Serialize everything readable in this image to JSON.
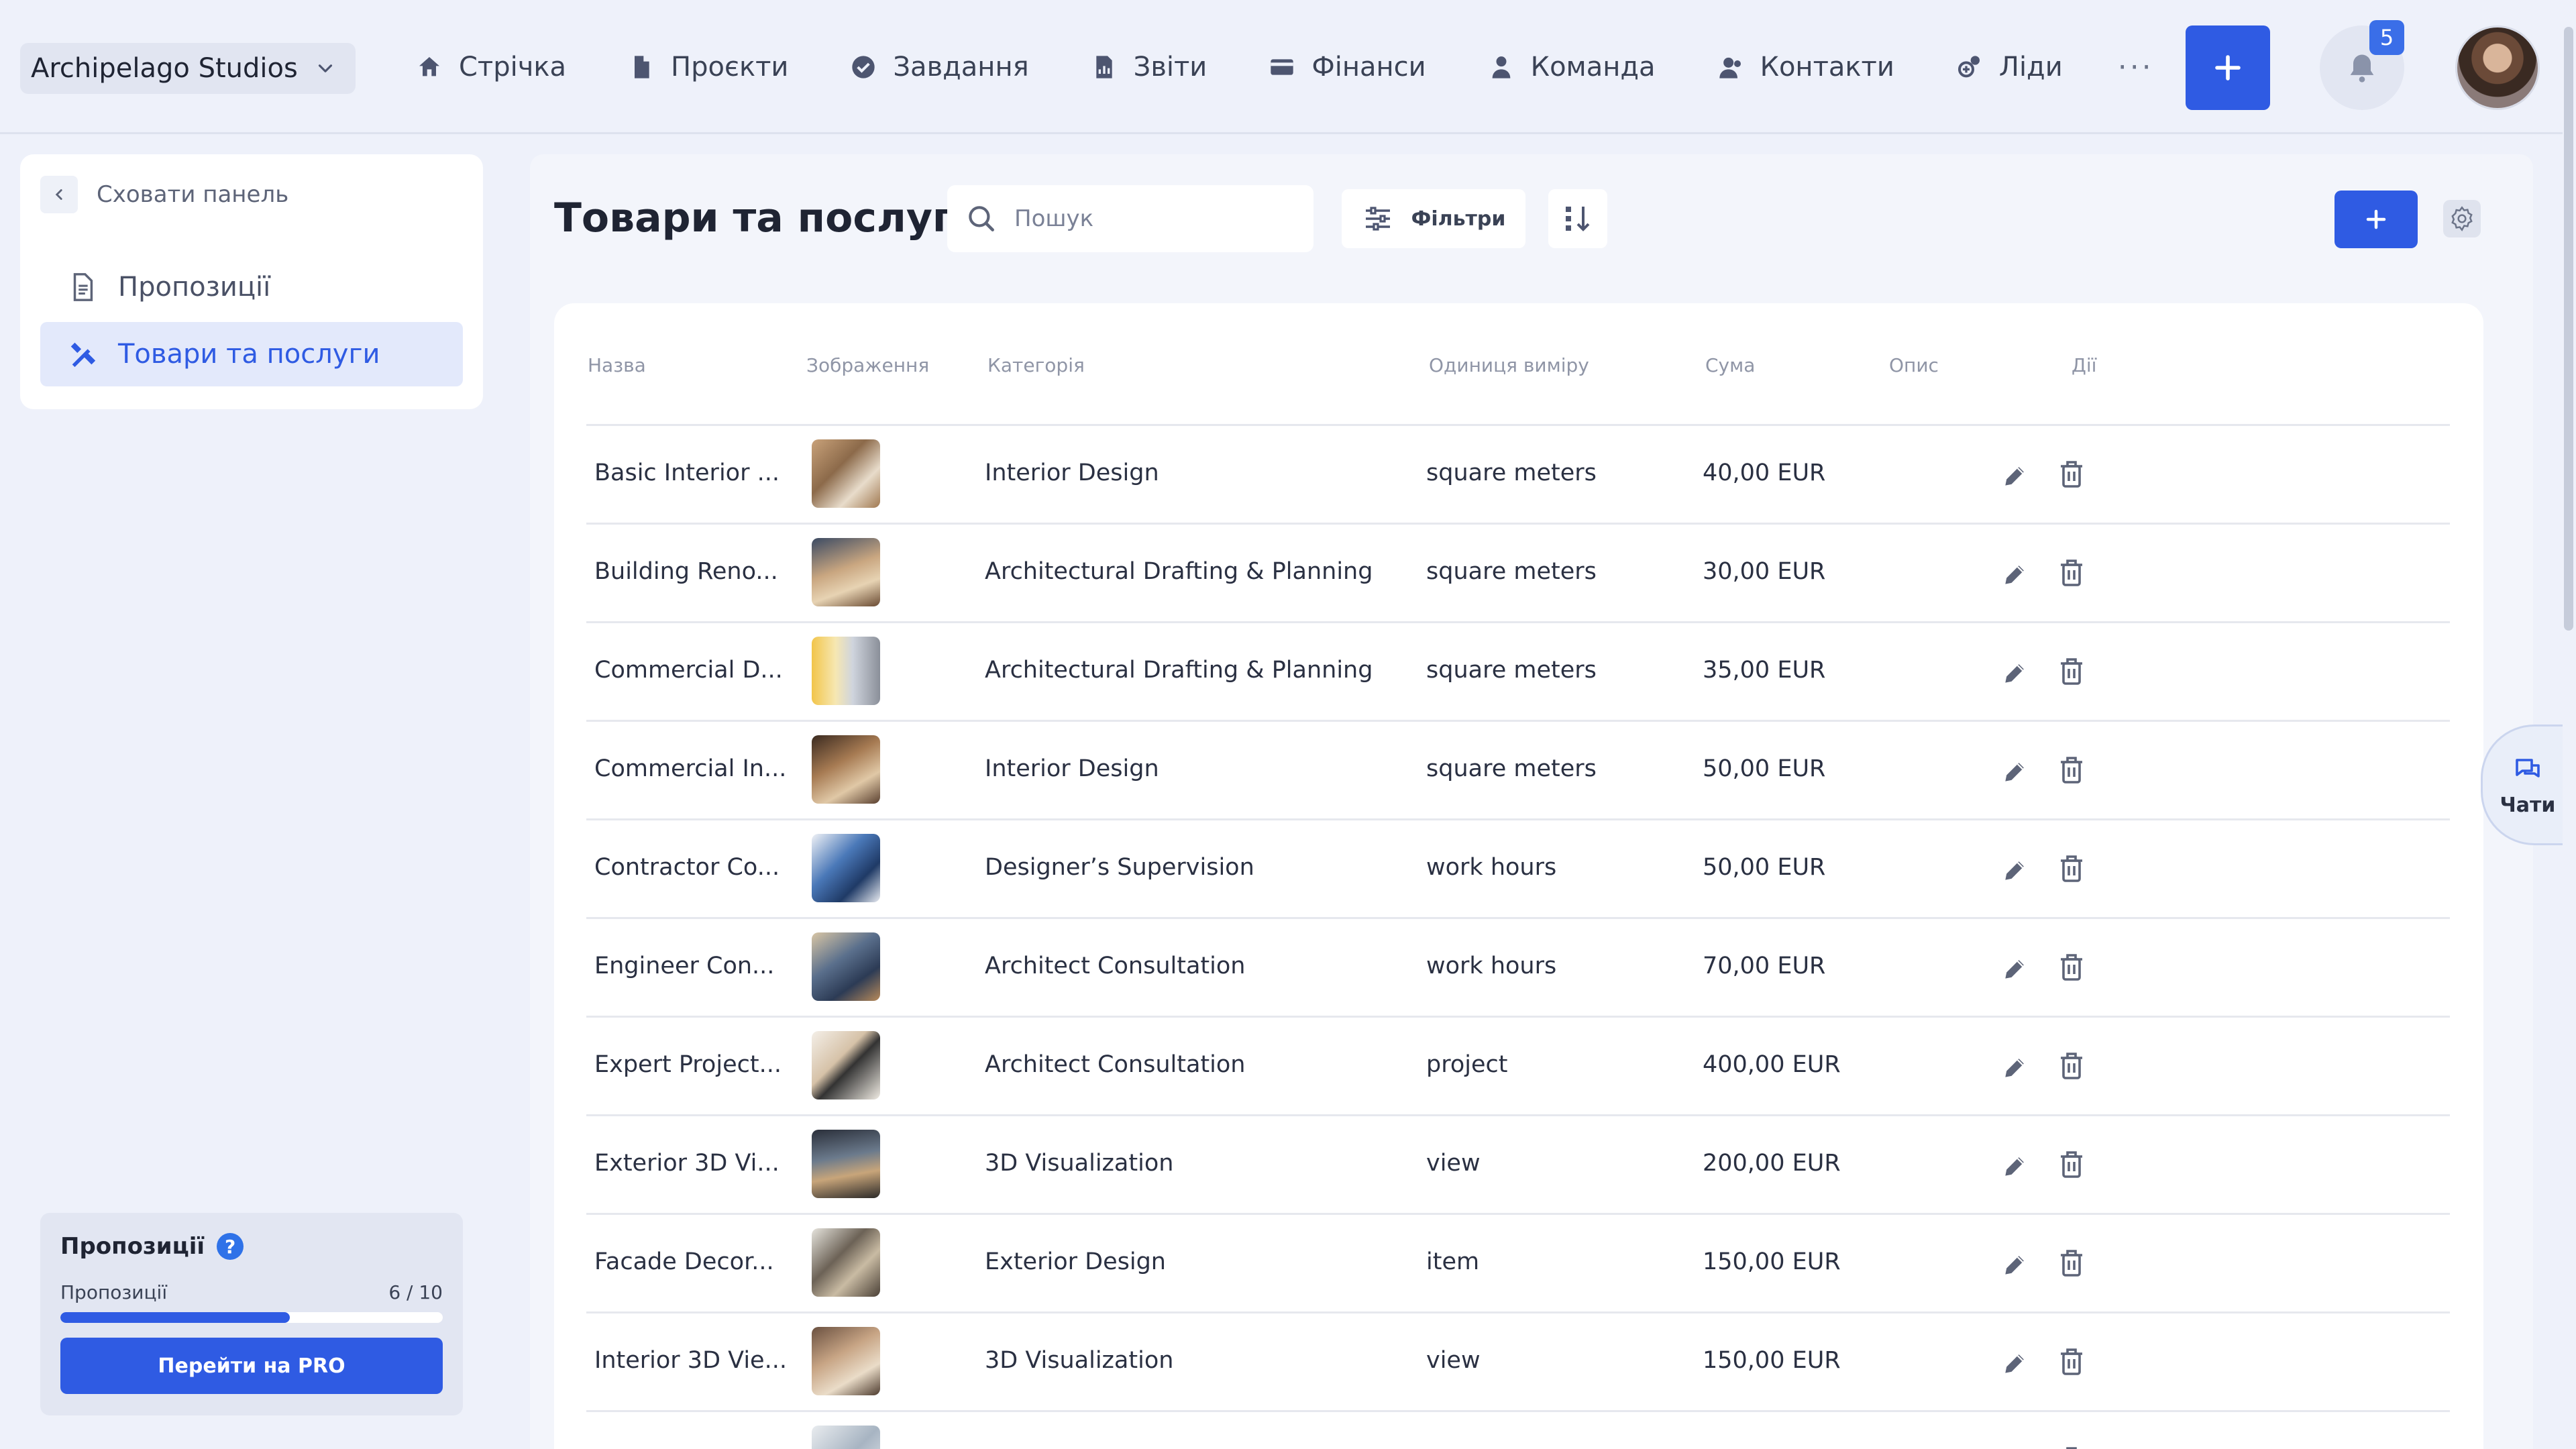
{
  "workspace": {
    "name": "Archipelago Studios"
  },
  "nav": [
    {
      "label": "Стрічка",
      "icon": "home-icon"
    },
    {
      "label": "Проєкти",
      "icon": "file-icon"
    },
    {
      "label": "Завдання",
      "icon": "check-circle-icon"
    },
    {
      "label": "Звіти",
      "icon": "report-icon"
    },
    {
      "label": "Фінанси",
      "icon": "card-icon"
    },
    {
      "label": "Команда",
      "icon": "person-icon"
    },
    {
      "label": "Контакти",
      "icon": "contacts-icon"
    },
    {
      "label": "Ліди",
      "icon": "leads-icon"
    }
  ],
  "nav_more": "···",
  "notifications": {
    "count": "5"
  },
  "sidebar": {
    "hide_label": "Сховати панель",
    "items": [
      {
        "label": "Пропозиції"
      },
      {
        "label": "Товари та послуги"
      }
    ],
    "plan": {
      "title": "Пропозиції",
      "help": "?",
      "usage_label": "Пропозиції",
      "usage_value": "6 / 10",
      "usage_fraction": 0.6,
      "button": "Перейти на PRO"
    }
  },
  "main": {
    "title": "Товари та послуги",
    "search_placeholder": "Пошук",
    "filters_label": "Фільтри",
    "add_label": "+"
  },
  "table": {
    "headers": [
      "Назва",
      "Зображення",
      "Категорія",
      "Одиниця виміру",
      "Сума",
      "Опис",
      "Дії"
    ],
    "rows": [
      {
        "name": "Basic Interior ...",
        "category": "Interior Design",
        "unit": "square meters",
        "amount": "40,00 EUR",
        "description": ""
      },
      {
        "name": "Building Reno...",
        "category": "Architectural Drafting & Planning",
        "unit": "square meters",
        "amount": "30,00 EUR",
        "description": ""
      },
      {
        "name": "Commercial D...",
        "category": "Architectural Drafting & Planning",
        "unit": "square meters",
        "amount": "35,00 EUR",
        "description": ""
      },
      {
        "name": "Commercial In...",
        "category": "Interior Design",
        "unit": "square meters",
        "amount": "50,00 EUR",
        "description": ""
      },
      {
        "name": "Contractor Co...",
        "category": "Designer’s Supervision",
        "unit": "work hours",
        "amount": "50,00 EUR",
        "description": ""
      },
      {
        "name": "Engineer Con...",
        "category": "Architect Consultation",
        "unit": "work hours",
        "amount": "70,00 EUR",
        "description": ""
      },
      {
        "name": "Expert Project...",
        "category": "Architect Consultation",
        "unit": "project",
        "amount": "400,00 EUR",
        "description": ""
      },
      {
        "name": "Exterior 3D Vi...",
        "category": "3D Visualization",
        "unit": "view",
        "amount": "200,00 EUR",
        "description": ""
      },
      {
        "name": "Facade Decor...",
        "category": "Exterior Design",
        "unit": "item",
        "amount": "150,00 EUR",
        "description": ""
      },
      {
        "name": "Interior 3D Vie...",
        "category": "3D Visualization",
        "unit": "view",
        "amount": "150,00 EUR",
        "description": ""
      },
      {
        "name": "",
        "category": "",
        "unit": "",
        "amount": "",
        "description": ""
      }
    ]
  },
  "chats": {
    "label": "Чати"
  },
  "colors": {
    "accent": "#2f5be3",
    "background": "#eef1fa",
    "card": "#ffffff"
  }
}
